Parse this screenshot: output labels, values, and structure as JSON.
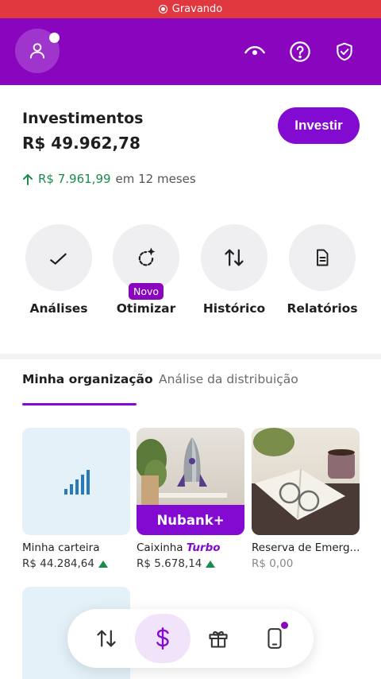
{
  "recording": {
    "label": "Gravando"
  },
  "header": {
    "icons": [
      "person-icon",
      "eye-icon",
      "help-icon",
      "shield-check-icon"
    ]
  },
  "balance": {
    "title": "Investimentos",
    "amount": "R$ 49.962,78",
    "invest_button": "Investir",
    "growth_value": "R$ 7.961,99",
    "growth_period": "em 12 meses"
  },
  "actions": [
    {
      "label": "Análises",
      "icon": "chart-trend-icon"
    },
    {
      "label": "Otimizar",
      "icon": "sparkle-refresh-icon",
      "badge": "Novo"
    },
    {
      "label": "Histórico",
      "icon": "arrows-up-down-icon"
    },
    {
      "label": "Relatórios",
      "icon": "document-icon"
    }
  ],
  "tabs": [
    {
      "label": "Minha organização",
      "active": true
    },
    {
      "label": "Análise da distribuição",
      "active": false
    }
  ],
  "cards": [
    {
      "name": "Minha carteira",
      "value": "R$ 44.284,64",
      "trend": "up"
    },
    {
      "name_prefix": "Caixinha ",
      "name_highlight": "Turbo",
      "value": "R$ 5.678,14",
      "trend": "up",
      "banner": "Nubank+"
    },
    {
      "name": "Reserva de Emerg...",
      "value": "R$ 0,00",
      "trend": "none"
    }
  ],
  "bottom_nav": {
    "items": [
      "transfer-icon",
      "dollar-icon",
      "gift-icon",
      "phone-icon"
    ],
    "active_index": 1
  },
  "colors": {
    "brand": "#820ad1",
    "header": "#8a05be",
    "positive": "#1b8a4c",
    "recording": "#e0383e"
  }
}
